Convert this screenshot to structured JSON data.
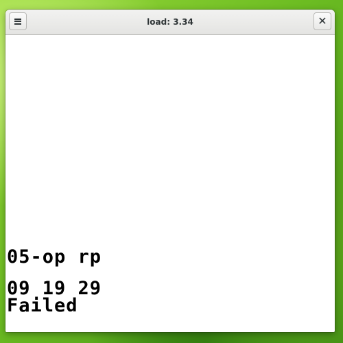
{
  "window": {
    "title": "load: 3.34",
    "menu_icon": "hamburger-menu-icon",
    "close_icon": "close-icon",
    "close_glyph": "✕"
  },
  "display": {
    "lines": [
      "05-op rp",
      "09 19 29",
      "Failed"
    ]
  }
}
